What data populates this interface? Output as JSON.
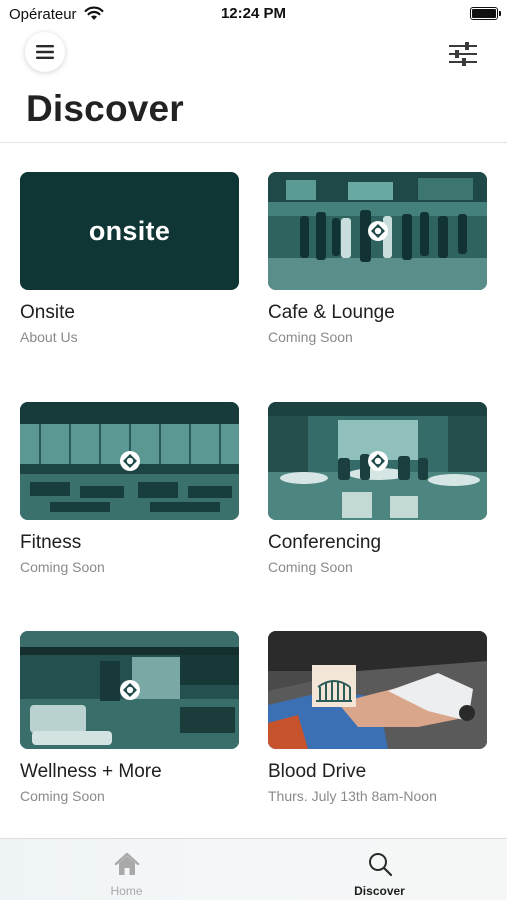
{
  "status_bar": {
    "carrier": "Opérateur",
    "time": "12:24 PM"
  },
  "header": {
    "menu_icon": "hamburger-menu-icon",
    "filter_icon": "sliders-filter-icon",
    "title": "Discover"
  },
  "cards": [
    {
      "title": "Onsite",
      "subtitle": "About Us",
      "logo_text": "onsite",
      "image": "onsite-logo"
    },
    {
      "title": "Cafe & Lounge",
      "subtitle": "Coming Soon",
      "image": "cafe-lounge-photo"
    },
    {
      "title": "Fitness",
      "subtitle": "Coming Soon",
      "image": "fitness-photo"
    },
    {
      "title": "Conferencing",
      "subtitle": "Coming Soon",
      "image": "conferencing-photo"
    },
    {
      "title": "Wellness + More",
      "subtitle": "Coming Soon",
      "image": "wellness-photo"
    },
    {
      "title": "Blood Drive",
      "subtitle": "Thurs. July 13th 8am-Noon",
      "image": "blood-drive-photo"
    }
  ],
  "tab_bar": {
    "tabs": [
      {
        "label": "Home",
        "icon": "home-icon",
        "active": false
      },
      {
        "label": "Discover",
        "icon": "search-icon",
        "active": true
      }
    ]
  },
  "colors": {
    "brand_dark_teal": "#0f3534",
    "photo_teal_tint": "#2e6562",
    "subtitle_gray": "#8a8a8a"
  }
}
